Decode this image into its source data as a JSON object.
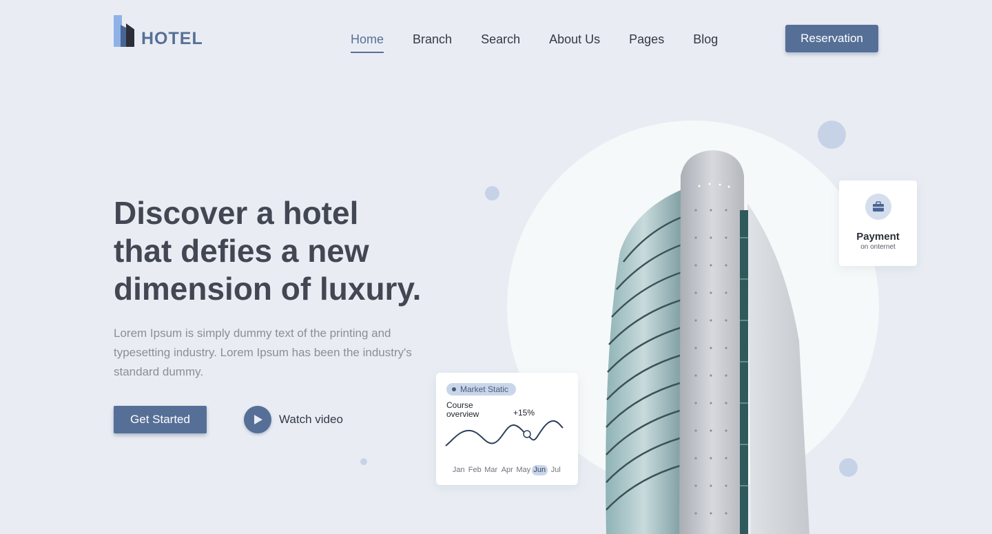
{
  "brand": {
    "name": "HOTEL"
  },
  "nav": {
    "items": [
      {
        "label": "Home",
        "active": true
      },
      {
        "label": "Branch"
      },
      {
        "label": "Search"
      },
      {
        "label": "About Us"
      },
      {
        "label": "Pages"
      },
      {
        "label": "Blog"
      }
    ],
    "cta": "Reservation"
  },
  "hero": {
    "title_lines": [
      "Discover a hotel",
      "that defies a new",
      "dimension of luxury."
    ],
    "description": "Lorem Ipsum is simply dummy text of the printing and typesetting industry. Lorem Ipsum has been the industry's standard dummy.",
    "primary_button": "Get Started",
    "video_button": "Watch video"
  },
  "payment_card": {
    "title": "Payment",
    "subtitle": "on onternet",
    "icon": "id-card-icon"
  },
  "market_card": {
    "badge": "Market Static",
    "title": "Course overview",
    "change": "+15%",
    "months": [
      "Jan",
      "Feb",
      "Mar",
      "Apr",
      "May",
      "Jun",
      "Jul"
    ],
    "active_month": "Jun"
  },
  "colors": {
    "background": "#e9edf3",
    "accent": "#566f97",
    "circle": "#f6f9f9",
    "dots": "#c6d3e7"
  }
}
